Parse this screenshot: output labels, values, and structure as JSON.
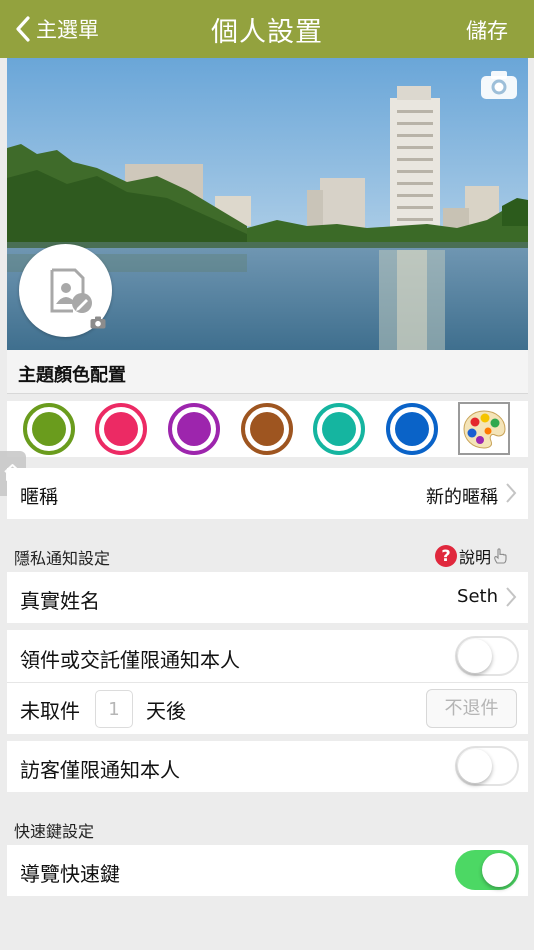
{
  "navbar": {
    "back_label": "主選單",
    "title": "個人設置",
    "save_label": "儲存",
    "background_color": "#93a23e"
  },
  "hero": {
    "camera_icon": "camera-icon",
    "avatar_icon": "edit-profile-doc-icon"
  },
  "theme": {
    "header": "主題顏色配置",
    "swatches": [
      {
        "name": "green",
        "color": "#6a9c1d"
      },
      {
        "name": "pink",
        "color": "#ec2a64"
      },
      {
        "name": "purple",
        "color": "#9d25ad"
      },
      {
        "name": "brown",
        "color": "#9e5520"
      },
      {
        "name": "teal",
        "color": "#15b5a0"
      },
      {
        "name": "blue",
        "color": "#0a63c8"
      }
    ],
    "palette_icon": "palette-icon"
  },
  "nickname": {
    "label": "暱稱",
    "value": "新的暱稱"
  },
  "privacy": {
    "section_label": "隱私通知設定",
    "help_label": "說明",
    "help_mark": "?",
    "real_name_label": "真實姓名",
    "real_name_value": "Seth",
    "parcel_notify_label": "領件或交託僅限通知本人",
    "parcel_notify_on": false,
    "unclaimed_prefix": "未取件",
    "unclaimed_days_placeholder": "1",
    "unclaimed_suffix": "天後",
    "no_return_label": "不退件",
    "visitor_notify_label": "訪客僅限通知本人",
    "visitor_notify_on": false
  },
  "shortcut": {
    "section_label": "快速鍵設定",
    "nav_shortcut_label": "導覽快速鍵",
    "nav_shortcut_on": true
  }
}
